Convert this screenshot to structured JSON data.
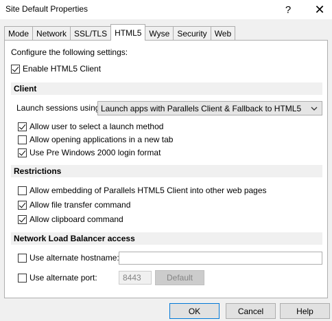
{
  "window": {
    "title": "Site Default Properties",
    "help_glyph": "?",
    "close_glyph": "✕"
  },
  "tabs": [
    {
      "label": "Mode",
      "active": false
    },
    {
      "label": "Network",
      "active": false
    },
    {
      "label": "SSL/TLS",
      "active": false
    },
    {
      "label": "HTML5",
      "active": true
    },
    {
      "label": "Wyse",
      "active": false
    },
    {
      "label": "Security",
      "active": false
    },
    {
      "label": "Web",
      "active": false
    }
  ],
  "configure_label": "Configure the following settings:",
  "enable_html5": {
    "label": "Enable HTML5 Client",
    "checked": true
  },
  "client": {
    "heading": "Client",
    "launch_label": "Launch sessions using:",
    "launch_value": "Launch apps with Parallels Client & Fallback to HTML5",
    "allow_select": {
      "label": "Allow user to select a launch method",
      "checked": true
    },
    "allow_new_tab": {
      "label": "Allow opening applications in a new tab",
      "checked": false
    },
    "pre_win2000": {
      "label": "Use Pre Windows 2000 login format",
      "checked": true
    }
  },
  "restrictions": {
    "heading": "Restrictions",
    "allow_embedding": {
      "label": "Allow embedding of Parallels HTML5 Client into other web pages",
      "checked": false
    },
    "allow_file_transfer": {
      "label": "Allow file transfer command",
      "checked": true
    },
    "allow_clipboard": {
      "label": "Allow clipboard command",
      "checked": true
    }
  },
  "nlb": {
    "heading": "Network Load Balancer access",
    "alt_hostname": {
      "label": "Use alternate hostname:",
      "checked": false,
      "value": ""
    },
    "alt_port": {
      "label": "Use alternate port:",
      "checked": false,
      "value": "8443"
    },
    "default_label": "Default"
  },
  "footer": {
    "ok": "OK",
    "cancel": "Cancel",
    "help": "Help"
  }
}
